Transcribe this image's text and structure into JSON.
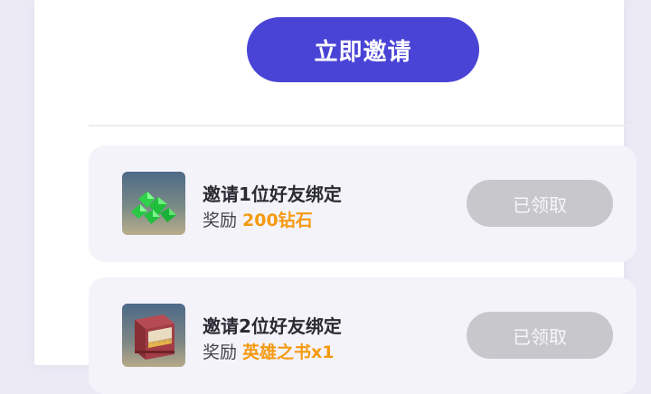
{
  "invite_button": {
    "label": "立即邀请"
  },
  "tasks": [
    {
      "title": "邀请1位好友绑定",
      "reward_label": "奖励",
      "reward_value": "200钻石",
      "icon": "green-gems-icon",
      "button_label": "已领取"
    },
    {
      "title": "邀请2位好友绑定",
      "reward_label": "奖励",
      "reward_value": "英雄之书x1",
      "icon": "hero-book-icon",
      "button_label": "已领取"
    }
  ],
  "colors": {
    "accent": "#4a44d6",
    "reward_highlight": "#f59a12",
    "claimed_button": "#c7c7cc"
  }
}
